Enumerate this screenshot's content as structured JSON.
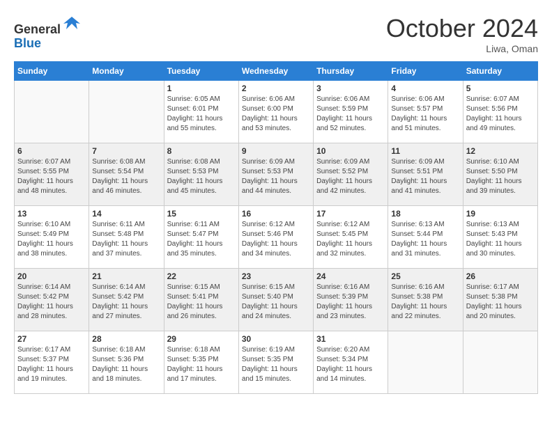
{
  "header": {
    "logo_line1": "General",
    "logo_line2": "Blue",
    "month": "October 2024",
    "location": "Liwa, Oman"
  },
  "days_of_week": [
    "Sunday",
    "Monday",
    "Tuesday",
    "Wednesday",
    "Thursday",
    "Friday",
    "Saturday"
  ],
  "weeks": [
    [
      {
        "day": "",
        "info": ""
      },
      {
        "day": "",
        "info": ""
      },
      {
        "day": "1",
        "info": "Sunrise: 6:05 AM\nSunset: 6:01 PM\nDaylight: 11 hours and 55 minutes."
      },
      {
        "day": "2",
        "info": "Sunrise: 6:06 AM\nSunset: 6:00 PM\nDaylight: 11 hours and 53 minutes."
      },
      {
        "day": "3",
        "info": "Sunrise: 6:06 AM\nSunset: 5:59 PM\nDaylight: 11 hours and 52 minutes."
      },
      {
        "day": "4",
        "info": "Sunrise: 6:06 AM\nSunset: 5:57 PM\nDaylight: 11 hours and 51 minutes."
      },
      {
        "day": "5",
        "info": "Sunrise: 6:07 AM\nSunset: 5:56 PM\nDaylight: 11 hours and 49 minutes."
      }
    ],
    [
      {
        "day": "6",
        "info": "Sunrise: 6:07 AM\nSunset: 5:55 PM\nDaylight: 11 hours and 48 minutes."
      },
      {
        "day": "7",
        "info": "Sunrise: 6:08 AM\nSunset: 5:54 PM\nDaylight: 11 hours and 46 minutes."
      },
      {
        "day": "8",
        "info": "Sunrise: 6:08 AM\nSunset: 5:53 PM\nDaylight: 11 hours and 45 minutes."
      },
      {
        "day": "9",
        "info": "Sunrise: 6:09 AM\nSunset: 5:53 PM\nDaylight: 11 hours and 44 minutes."
      },
      {
        "day": "10",
        "info": "Sunrise: 6:09 AM\nSunset: 5:52 PM\nDaylight: 11 hours and 42 minutes."
      },
      {
        "day": "11",
        "info": "Sunrise: 6:09 AM\nSunset: 5:51 PM\nDaylight: 11 hours and 41 minutes."
      },
      {
        "day": "12",
        "info": "Sunrise: 6:10 AM\nSunset: 5:50 PM\nDaylight: 11 hours and 39 minutes."
      }
    ],
    [
      {
        "day": "13",
        "info": "Sunrise: 6:10 AM\nSunset: 5:49 PM\nDaylight: 11 hours and 38 minutes."
      },
      {
        "day": "14",
        "info": "Sunrise: 6:11 AM\nSunset: 5:48 PM\nDaylight: 11 hours and 37 minutes."
      },
      {
        "day": "15",
        "info": "Sunrise: 6:11 AM\nSunset: 5:47 PM\nDaylight: 11 hours and 35 minutes."
      },
      {
        "day": "16",
        "info": "Sunrise: 6:12 AM\nSunset: 5:46 PM\nDaylight: 11 hours and 34 minutes."
      },
      {
        "day": "17",
        "info": "Sunrise: 6:12 AM\nSunset: 5:45 PM\nDaylight: 11 hours and 32 minutes."
      },
      {
        "day": "18",
        "info": "Sunrise: 6:13 AM\nSunset: 5:44 PM\nDaylight: 11 hours and 31 minutes."
      },
      {
        "day": "19",
        "info": "Sunrise: 6:13 AM\nSunset: 5:43 PM\nDaylight: 11 hours and 30 minutes."
      }
    ],
    [
      {
        "day": "20",
        "info": "Sunrise: 6:14 AM\nSunset: 5:42 PM\nDaylight: 11 hours and 28 minutes."
      },
      {
        "day": "21",
        "info": "Sunrise: 6:14 AM\nSunset: 5:42 PM\nDaylight: 11 hours and 27 minutes."
      },
      {
        "day": "22",
        "info": "Sunrise: 6:15 AM\nSunset: 5:41 PM\nDaylight: 11 hours and 26 minutes."
      },
      {
        "day": "23",
        "info": "Sunrise: 6:15 AM\nSunset: 5:40 PM\nDaylight: 11 hours and 24 minutes."
      },
      {
        "day": "24",
        "info": "Sunrise: 6:16 AM\nSunset: 5:39 PM\nDaylight: 11 hours and 23 minutes."
      },
      {
        "day": "25",
        "info": "Sunrise: 6:16 AM\nSunset: 5:38 PM\nDaylight: 11 hours and 22 minutes."
      },
      {
        "day": "26",
        "info": "Sunrise: 6:17 AM\nSunset: 5:38 PM\nDaylight: 11 hours and 20 minutes."
      }
    ],
    [
      {
        "day": "27",
        "info": "Sunrise: 6:17 AM\nSunset: 5:37 PM\nDaylight: 11 hours and 19 minutes."
      },
      {
        "day": "28",
        "info": "Sunrise: 6:18 AM\nSunset: 5:36 PM\nDaylight: 11 hours and 18 minutes."
      },
      {
        "day": "29",
        "info": "Sunrise: 6:18 AM\nSunset: 5:35 PM\nDaylight: 11 hours and 17 minutes."
      },
      {
        "day": "30",
        "info": "Sunrise: 6:19 AM\nSunset: 5:35 PM\nDaylight: 11 hours and 15 minutes."
      },
      {
        "day": "31",
        "info": "Sunrise: 6:20 AM\nSunset: 5:34 PM\nDaylight: 11 hours and 14 minutes."
      },
      {
        "day": "",
        "info": ""
      },
      {
        "day": "",
        "info": ""
      }
    ]
  ]
}
